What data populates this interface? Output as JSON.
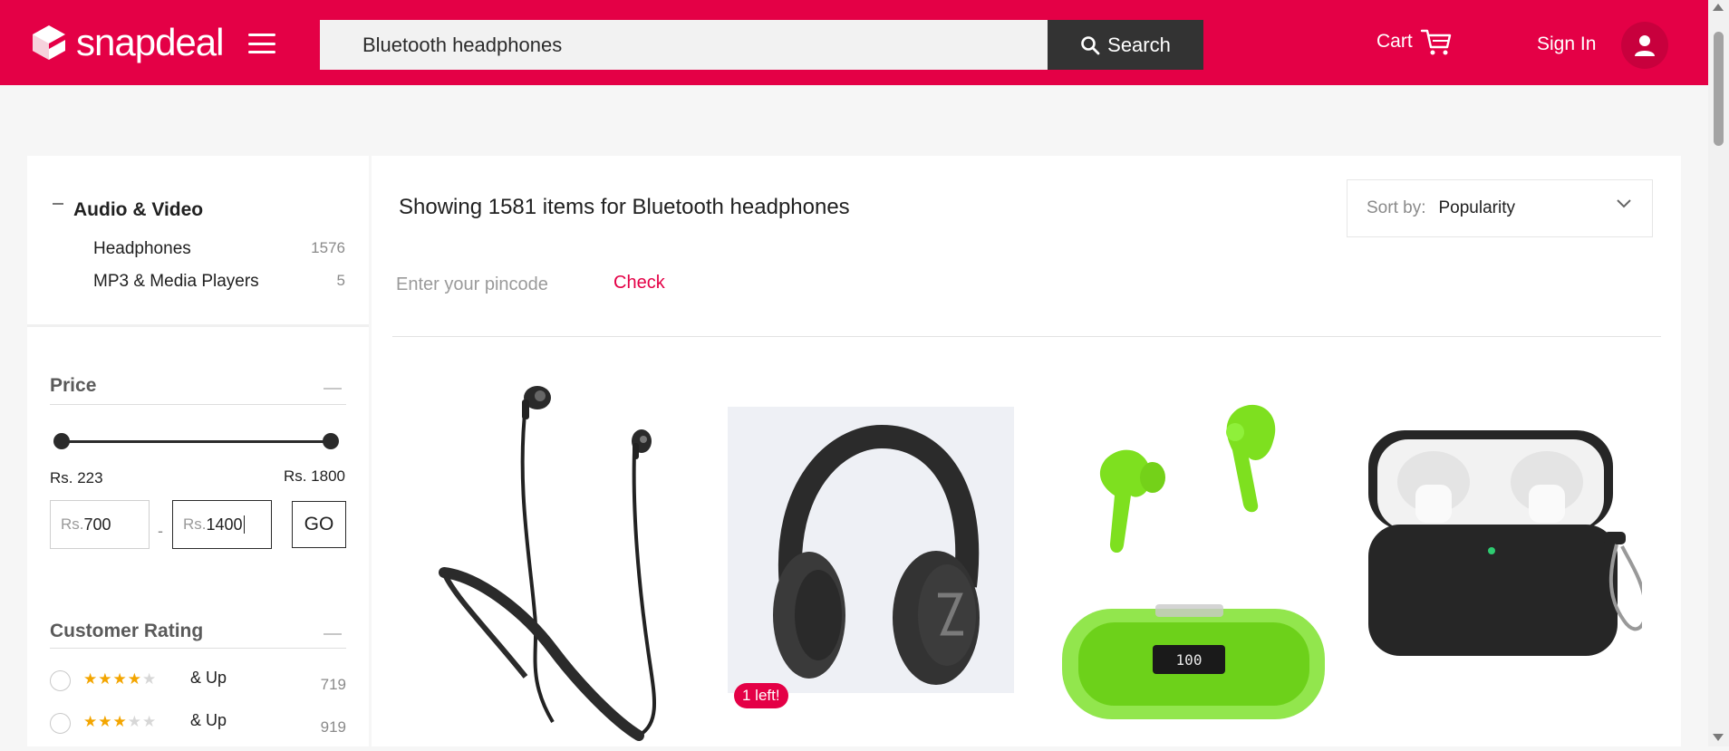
{
  "header": {
    "logo_text": "snapdeal",
    "search_value": "Bluetooth headphones",
    "search_button": "Search",
    "cart_label": "Cart",
    "signin_label": "Sign In"
  },
  "sidebar": {
    "category_title": "Audio & Video",
    "categories": [
      {
        "label": "Headphones",
        "count": "1576"
      },
      {
        "label": "MP3 & Media Players",
        "count": "5"
      }
    ],
    "price": {
      "title": "Price",
      "range_min_label": "Rs. 223",
      "range_max_label": "Rs. 1800",
      "currency_prefix": "Rs.",
      "min_value": "700",
      "max_value": "1400",
      "separator": "-",
      "go_label": "GO",
      "slider_low_fraction": 0,
      "slider_high_fraction": 1
    },
    "rating": {
      "title": "Customer Rating",
      "rows": [
        {
          "stars": 4,
          "label": "& Up",
          "count": "719"
        },
        {
          "stars": 3,
          "label": "& Up",
          "count": "919"
        }
      ]
    }
  },
  "main": {
    "showing_text": "Showing 1581 items for Bluetooth headphones",
    "sort_label": "Sort by:",
    "sort_value": "Popularity",
    "pincode_placeholder": "Enter your pincode",
    "check_label": "Check",
    "products": [
      {
        "name": "neckband-earphones",
        "badge": ""
      },
      {
        "name": "over-ear-headphones",
        "badge": "1 left!"
      },
      {
        "name": "green-tws-earbuds",
        "badge": ""
      },
      {
        "name": "earbuds-black-case",
        "badge": ""
      }
    ]
  },
  "colors": {
    "brand": "#e40046",
    "search_button": "#333333",
    "star": "#f3a500"
  }
}
